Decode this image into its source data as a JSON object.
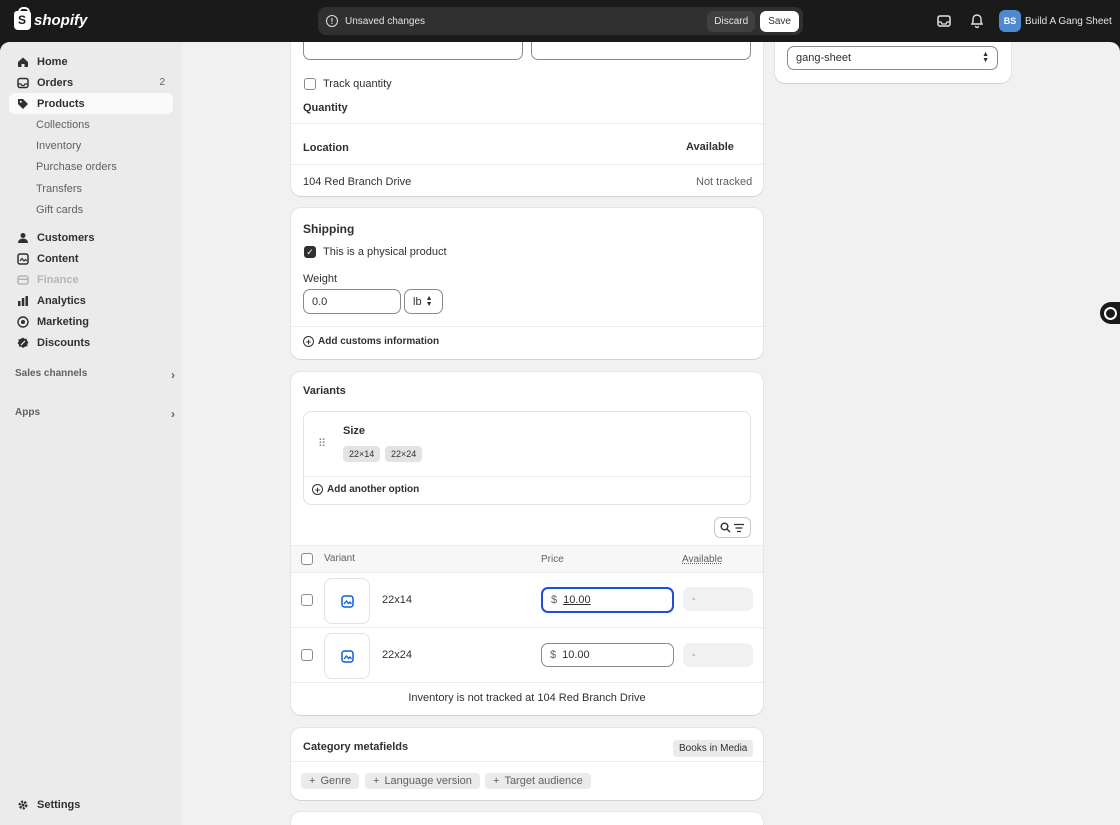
{
  "topbar": {
    "logo_text": "shopify",
    "unsaved_message": "Unsaved changes",
    "discard_label": "Discard",
    "save_label": "Save",
    "store_initials": "BS",
    "store_name": "Build A Gang Sheet"
  },
  "sidebar": {
    "items": [
      {
        "label": "Home",
        "icon": "home-icon"
      },
      {
        "label": "Orders",
        "icon": "orders-icon",
        "badge": "2"
      },
      {
        "label": "Products",
        "icon": "tag-icon"
      },
      {
        "label": "Collections"
      },
      {
        "label": "Inventory"
      },
      {
        "label": "Purchase orders"
      },
      {
        "label": "Transfers"
      },
      {
        "label": "Gift cards"
      },
      {
        "label": "Customers",
        "icon": "person-icon"
      },
      {
        "label": "Content",
        "icon": "content-icon"
      },
      {
        "label": "Finance",
        "icon": "finance-icon"
      },
      {
        "label": "Analytics",
        "icon": "analytics-icon"
      },
      {
        "label": "Marketing",
        "icon": "target-icon"
      },
      {
        "label": "Discounts",
        "icon": "discount-icon"
      }
    ],
    "sales_channels": "Sales channels",
    "apps": "Apps",
    "settings": "Settings"
  },
  "inventory": {
    "track_quantity": "Track quantity",
    "quantity_heading": "Quantity",
    "location_header": "Location",
    "available_header": "Available",
    "location_name": "104 Red Branch Drive",
    "location_status": "Not tracked"
  },
  "shipping": {
    "title": "Shipping",
    "physical_label": "This is a physical product",
    "weight_label": "Weight",
    "weight_value": "0.0",
    "weight_unit": "lb",
    "customs_label": "Add customs information"
  },
  "variants": {
    "title": "Variants",
    "option_name": "Size",
    "option_values": [
      "22×14",
      "22×24"
    ],
    "add_option": "Add another option",
    "col_variant": "Variant",
    "col_price": "Price",
    "col_available": "Available",
    "rows": [
      {
        "name": "22x14",
        "currency": "$",
        "price": "10.00",
        "available": "-"
      },
      {
        "name": "22x24",
        "currency": "$",
        "price": "10.00",
        "available": "-"
      }
    ],
    "footer": "Inventory is not tracked at 104 Red Branch Drive"
  },
  "metafields": {
    "title": "Category metafields",
    "category": "Books in Media",
    "tags": [
      "Genre",
      "Language version",
      "Target audience"
    ]
  },
  "right_panel": {
    "template_value": "gang-sheet"
  }
}
